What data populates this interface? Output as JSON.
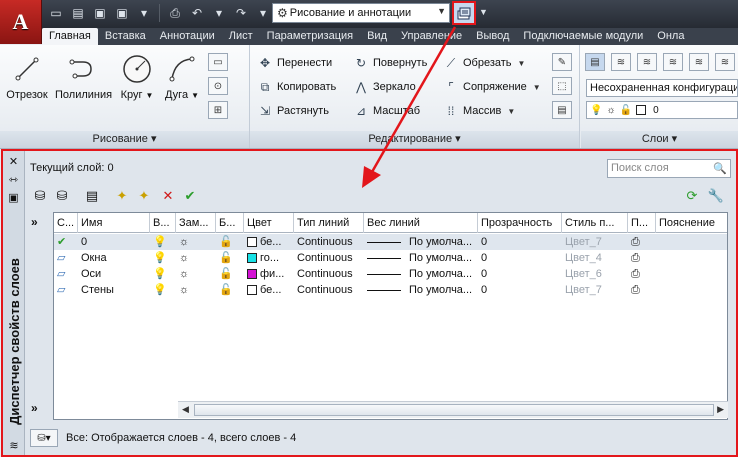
{
  "workspace": {
    "value": "Рисование и аннотации"
  },
  "tabs": [
    "Главная",
    "Вставка",
    "Аннотации",
    "Лист",
    "Параметризация",
    "Вид",
    "Управление",
    "Вывод",
    "Подключаемые модули",
    "Онла"
  ],
  "draw_panel": {
    "title": "Рисование",
    "tools": [
      "Отрезок",
      "Полилиния",
      "Круг",
      "Дуга"
    ]
  },
  "modify_panel": {
    "title": "Редактирование",
    "tools": [
      "Перенести",
      "Повернуть",
      "Обрезать",
      "Копировать",
      "Зеркало",
      "Сопряжение",
      "Растянуть",
      "Масштаб",
      "Массив"
    ]
  },
  "layers_panel": {
    "title": "Слои",
    "state": "Несохраненная конфигурация",
    "current_layer_num": "0"
  },
  "palette": {
    "title": "Диспетчер свойств слоев",
    "current_layer": "Текущий слой: 0",
    "search_placeholder": "Поиск слоя",
    "columns": [
      "С...",
      "Имя",
      "В...",
      "Зам...",
      "Б...",
      "Цвет",
      "Тип линий",
      "Вес линий",
      "Прозрачность",
      "Стиль п...",
      "П...",
      "Пояснение"
    ],
    "rows": [
      {
        "name": "0",
        "color_name": "бе...",
        "color": "#ffffff",
        "linetype": "Continuous",
        "lineweight": "По умолча...",
        "transparency": "0",
        "plot_style": "Цвет_7"
      },
      {
        "name": "Окна",
        "color_name": "го...",
        "color": "#18e2e6",
        "linetype": "Continuous",
        "lineweight": "По умолча...",
        "transparency": "0",
        "plot_style": "Цвет_4"
      },
      {
        "name": "Оси",
        "color_name": "фи...",
        "color": "#d313d3",
        "linetype": "Continuous",
        "lineweight": "По умолча...",
        "transparency": "0",
        "plot_style": "Цвет_6"
      },
      {
        "name": "Стены",
        "color_name": "бе...",
        "color": "#ffffff",
        "linetype": "Continuous",
        "lineweight": "По умолча...",
        "transparency": "0",
        "plot_style": "Цвет_7"
      }
    ],
    "expand_glyph": "»",
    "status": "Все: Отображается слоев - 4, всего слоев - 4"
  },
  "colors": {
    "highlight": "#e3161b",
    "app_red": "#c72a25"
  }
}
